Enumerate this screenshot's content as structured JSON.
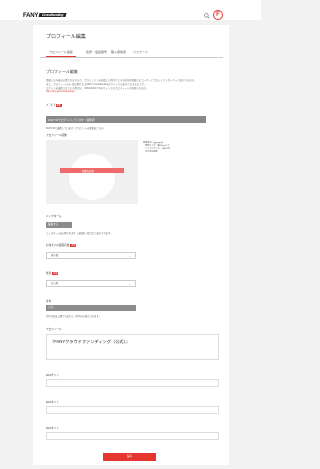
{
  "header": {
    "logo_main": "FANY",
    "logo_sub": "Crowdfunding",
    "avatar_letter": "F"
  },
  "page": {
    "title": "プロフィール編集"
  },
  "tabs": [
    {
      "label": "プロフィール編集"
    },
    {
      "label": "住所・電話番号"
    },
    {
      "label": "購入者情報"
    },
    {
      "label": "パスワード"
    }
  ],
  "section": {
    "title": "プロフィール編集",
    "desc_lines": [
      "登録した内容は公開されますので、プロジェクトを支援した際などにその名前が掲載されユーザーとプロジェクトオーナーと表示されます。",
      "また、プロフィールは一般公開されるFANY Crowdfundingのサイトでも表示されるものです。",
      "ログインを連携されている場合は、SNSやFANY IDのサイトでのプロフィールが反映されます。",
      "http://fany.jp/crowdfunding/..."
    ]
  },
  "social": {
    "icons": "✓ 𝕏 f",
    "badge": "連携"
  },
  "sns_bar": {
    "text": "FANY IDでログインしています（連携済）"
  },
  "sns_note": "FANY IDで連携しています（アカウントの変更はこちら）",
  "image_field": {
    "label": "プロフィール画像",
    "band_text": "画像を変更",
    "notes": [
      "画像形式：jpg/png/gif",
      "・推奨サイズ：横400px以上",
      "・ファイルサイズ：5MB以内",
      "・正方形の画像"
    ]
  },
  "nickname": {
    "label": "ニックネーム",
    "button": "編集する",
    "note": "ニックネームは公開されます（支援者一覧などに表示されます）"
  },
  "prefecture": {
    "label": "お住まいの都道府県",
    "required": "必須",
    "value": "東京都"
  },
  "gender": {
    "label": "性別",
    "required": "必須",
    "value": "非公開"
  },
  "birthday": {
    "label": "生年",
    "button": "入力",
    "note": "生年月日は公開されません（年代のみ表示されます）"
  },
  "profile": {
    "label": "プロフィール",
    "value": "『FANYクラウドファンディング（公式）』"
  },
  "web_fields": [
    {
      "label": "Webサイト"
    },
    {
      "label": "Webサイト"
    },
    {
      "label": "Webサイト"
    },
    {
      "label": "Webサイト"
    }
  ],
  "submit_label": "保存"
}
